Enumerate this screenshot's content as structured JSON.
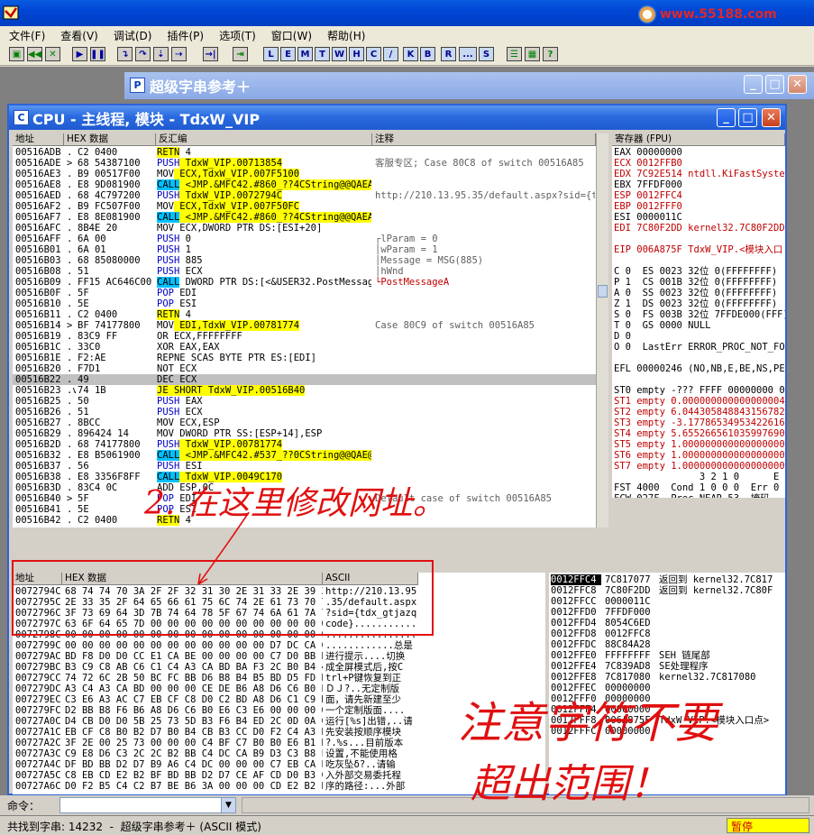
{
  "app": {
    "watermark": "www.55188.com"
  },
  "menu": [
    "文件(F)",
    "查看(V)",
    "调试(D)",
    "插件(P)",
    "选项(T)",
    "窗口(W)",
    "帮助(H)"
  ],
  "toolbar": {
    "letters": [
      "L",
      "E",
      "M",
      "T",
      "W",
      "H",
      "C",
      "/",
      "K",
      "B",
      "R",
      "...",
      "S"
    ]
  },
  "windows": {
    "strref_title": "超级字串参考＋",
    "cpu_title": "CPU - 主线程, 模块 - TdxW_VIP"
  },
  "disasm": {
    "headers": {
      "addr": "地址",
      "hex": "HEX 数据",
      "dis": "反汇编",
      "comment": "注释"
    },
    "rows": [
      {
        "a": "00516ADB",
        "m": ".",
        "h": "C2 0400",
        "d": "RETN 4",
        "c": ""
      },
      {
        "a": "00516ADE",
        "m": ">",
        "h": "68 54387100",
        "d": "PUSH TdxW_VIP.00713854",
        "c": "客服专区; Case 80C8 of switch 00516A85"
      },
      {
        "a": "00516AE3",
        "m": ".",
        "h": "B9 00517F00",
        "d": "MOV ECX,TdxW_VIP.007F5100",
        "c": ""
      },
      {
        "a": "00516AE8",
        "m": ".",
        "h": "E8 9D081900",
        "d": "CALL <JMP.&MFC42.#860_??4CString@@QAEAB",
        "c": ""
      },
      {
        "a": "00516AED",
        "m": ".",
        "h": "68 4C797200",
        "d": "PUSH TdxW_VIP.0072794C",
        "c": "http://210.13.95.35/default.aspx?sid={tc"
      },
      {
        "a": "00516AF2",
        "m": ".",
        "h": "B9 FC507F00",
        "d": "MOV ECX,TdxW_VIP.007F50FC",
        "c": ""
      },
      {
        "a": "00516AF7",
        "m": ".",
        "h": "E8 8E081900",
        "d": "CALL <JMP.&MFC42.#860_??4CString@@QAEAB",
        "c": ""
      },
      {
        "a": "00516AFC",
        "m": ".",
        "h": "8B4E 20",
        "d": "MOV ECX,DWORD PTR DS:[ESI+20]",
        "c": ""
      },
      {
        "a": "00516AFF",
        "m": ".",
        "h": "6A 00",
        "d": "PUSH 0",
        "c": "┌lParam = 0"
      },
      {
        "a": "00516B01",
        "m": ".",
        "h": "6A 01",
        "d": "PUSH 1",
        "c": "│wParam = 1"
      },
      {
        "a": "00516B03",
        "m": ".",
        "h": "68 85080000",
        "d": "PUSH 885",
        "c": "│Message = MSG(885)"
      },
      {
        "a": "00516B08",
        "m": ".",
        "h": "51",
        "d": "PUSH ECX",
        "c": "│hWnd"
      },
      {
        "a": "00516B09",
        "m": ".",
        "h": "FF15 AC646C00",
        "d": "CALL DWORD PTR DS:[<&USER32.PostMessage",
        "c": "└PostMessageA"
      },
      {
        "a": "00516B0F",
        "m": ".",
        "h": "5F",
        "d": "POP EDI",
        "c": ""
      },
      {
        "a": "00516B10",
        "m": ".",
        "h": "5E",
        "d": "POP ESI",
        "c": ""
      },
      {
        "a": "00516B11",
        "m": ".",
        "h": "C2 0400",
        "d": "RETN 4",
        "c": ""
      },
      {
        "a": "00516B14",
        "m": ">",
        "h": "BF 74177800",
        "d": "MOV EDI,TdxW_VIP.00781774",
        "c": "Case 80C9 of switch 00516A85"
      },
      {
        "a": "00516B19",
        "m": ".",
        "h": "83C9 FF",
        "d": "OR ECX,FFFFFFFF",
        "c": ""
      },
      {
        "a": "00516B1C",
        "m": ".",
        "h": "33C0",
        "d": "XOR EAX,EAX",
        "c": ""
      },
      {
        "a": "00516B1E",
        "m": ".",
        "h": "F2:AE",
        "d": "REPNE SCAS BYTE PTR ES:[EDI]",
        "c": ""
      },
      {
        "a": "00516B20",
        "m": ".",
        "h": "F7D1",
        "d": "NOT ECX",
        "c": ""
      },
      {
        "a": "00516B22",
        "m": ".",
        "h": "49",
        "d": "DEC ECX",
        "c": ""
      },
      {
        "a": "00516B23",
        "m": ".v",
        "h": "74 1B",
        "d": "JE SHORT TdxW_VIP.00516B40",
        "c": ""
      },
      {
        "a": "00516B25",
        "m": ".",
        "h": "50",
        "d": "PUSH EAX",
        "c": ""
      },
      {
        "a": "00516B26",
        "m": ".",
        "h": "51",
        "d": "PUSH ECX",
        "c": ""
      },
      {
        "a": "00516B27",
        "m": ".",
        "h": "8BCC",
        "d": "MOV ECX,ESP",
        "c": ""
      },
      {
        "a": "00516B29",
        "m": ".",
        "h": "896424 14",
        "d": "MOV DWORD PTR SS:[ESP+14],ESP",
        "c": ""
      },
      {
        "a": "00516B2D",
        "m": ".",
        "h": "68 74177800",
        "d": "PUSH TdxW_VIP.00781774",
        "c": ""
      },
      {
        "a": "00516B32",
        "m": ".",
        "h": "E8 B5061900",
        "d": "CALL <JMP.&MFC42.#537_??0CString@@QAE@P",
        "c": ""
      },
      {
        "a": "00516B37",
        "m": ".",
        "h": "56",
        "d": "PUSH ESI",
        "c": ""
      },
      {
        "a": "00516B38",
        "m": ".",
        "h": "E8 3356F8FF",
        "d": "CALL TdxW_VIP.0049C170",
        "c": ""
      },
      {
        "a": "00516B3D",
        "m": ".",
        "h": "83C4 0C",
        "d": "ADD ESP,0C",
        "c": ""
      },
      {
        "a": "00516B40",
        "m": ">",
        "h": "5F",
        "d": "POP EDI",
        "c": "Default case of switch 00516A85"
      },
      {
        "a": "00516B41",
        "m": ".",
        "h": "5E",
        "d": "POP ESI",
        "c": ""
      },
      {
        "a": "00516B42",
        "m": ".",
        "h": "C2 0400",
        "d": "RETN 4",
        "c": ""
      }
    ]
  },
  "registers": {
    "header": "寄存器 (FPU)",
    "lines": [
      "EAX 00000000",
      "ECX 0012FFB0",
      "EDX 7C92E514 ntdll.KiFastSystem",
      "EBX 7FFDF000",
      "ESP 0012FFC4",
      "EBP 0012FFF0",
      "ESI 0000011C",
      "EDI 7C80F2DD kernel32.7C80F2DD",
      "",
      "EIP 006A875F TdxW_VIP.<模块入口",
      "",
      "C 0  ES 0023 32位 0(FFFFFFFF)",
      "P 1  CS 001B 32位 0(FFFFFFFF)",
      "A 0  SS 0023 32位 0(FFFFFFFF)",
      "Z 1  DS 0023 32位 0(FFFFFFFF)",
      "S 0  FS 003B 32位 7FFDE000(FFF)",
      "T 0  GS 0000 NULL",
      "D 0",
      "O 0  LastErr ERROR_PROC_NOT_FOU",
      "",
      "EFL 00000246 (NO,NB,E,BE,NS,PE,",
      "",
      "ST0 empty -??? FFFF 00000000 00",
      "ST1 empty 0.0000000000000000040",
      "ST2 empty 6.0443058488431567820",
      "ST3 empty -3.177865349534226164",
      "ST4 empty 5.6552665610359976900",
      "ST5 empty 1.0000000000000000000",
      "ST6 empty 1.0000000000000000000",
      "ST7 empty 1.0000000000000000000",
      "               3 2 1 0      E S",
      "FST 4000  Cond 1 0 0 0  Err 0 0",
      "FCW 027F  Prec NEAR,53  掩码"
    ]
  },
  "dump": {
    "headers": {
      "addr": "地址",
      "hex": "HEX 数据",
      "ascii": "ASCII"
    },
    "rows": [
      {
        "a": "0072794C",
        "h": "68 74 74 70 3A 2F 2F 32 31 30 2E 31 33 2E 39 35",
        "s": "http://210.13.95"
      },
      {
        "a": "0072795C",
        "h": "2E 33 35 2F 64 65 66 61 75 6C 74 2E 61 73 70 78",
        "s": ".35/default.aspx"
      },
      {
        "a": "0072796C",
        "h": "3F 73 69 64 3D 7B 74 64 78 5F 67 74 6A 61 7A 71",
        "s": "?sid={tdx_gtjazq"
      },
      {
        "a": "0072797C",
        "h": "63 6F 64 65 7D 00 00 00 00 00 00 00 00 00 00 00",
        "s": "code}..........."
      },
      {
        "a": "0072798C",
        "h": "00 00 00 00 00 00 00 00 00 00 00 00 00 00 00 00",
        "s": "................"
      },
      {
        "a": "0072799C",
        "h": "00 00 00 00 00 00 00 00 00 00 00 00 D7 DC CA C7",
        "s": "............总是"
      },
      {
        "a": "007279AC",
        "h": "BD F8 D0 D0 CC E1 CA BE 00 00 00 00 C7 D0 BB BB",
        "s": "进行提示....切换"
      },
      {
        "a": "007279BC",
        "h": "B3 C9 C8 AB C6 C1 C4 A3 CA BD BA F3 2C B0 B4 43",
        "s": "成全屏模式后,按C"
      },
      {
        "a": "007279CC",
        "h": "74 72 6C 2B 50 BC FC BB D6 B8 B4 B5 BD D5 FD B3",
        "s": "trl+P键恢复到正"
      },
      {
        "a": "007279DC",
        "h": "A3 C4 A3 CA BD 00 00 00 CE DE B6 A8 D6 C6 B0 E6",
        "s": "ＤＪ?..无定制版"
      },
      {
        "a": "007279EC",
        "h": "C3 E6 A3 AC C7 EB CF C8 D0 C2 BD A8 D6 C1 C9 D9",
        "s": "面，请先新建至少"
      },
      {
        "a": "007279FC",
        "h": "D2 BB B8 F6 B6 A8 D6 C6 B0 E6 C3 E6 00 00 00 00",
        "s": "一个定制版面...."
      },
      {
        "a": "00727A0C",
        "h": "D4 CB D0 D0 5B 25 73 5D B3 F6 B4 ED 2C 0D 0A C7",
        "s": "运行[%s]出错,..请"
      },
      {
        "a": "00727A1C",
        "h": "EB CF C8 B0 B2 D7 B0 B4 CB B3 CC D0 F2 C4 A3 BF",
        "s": "先安装按顺序模块"
      },
      {
        "a": "00727A2C",
        "h": "3F 2E 00 25 73 00 00 00 C4 BF C7 B0 B0 E6 B1 BE",
        "s": "?.%s...目前版本"
      },
      {
        "a": "00727A3C",
        "h": "C9 E8 D6 C3 2C 2C B2 BB C4 DC CA B9 D3 C3 B8 F1",
        "s": "设置,不能使用格"
      },
      {
        "a": "00727A4C",
        "h": "DF BD BB D2 D7 B9 A6 C4 DC 00 00 00 C7 EB CA E4",
        "s": "吃灰坠δ?..请输"
      },
      {
        "a": "00727A5C",
        "h": "C8 EB CD E2 B2 BF BD BB D2 D7 CE AF CD D0 B3 CC",
        "s": "入外部交易委托程"
      },
      {
        "a": "00727A6C",
        "h": "D0 F2 B5 C4 C2 B7 BE B6 3A 00 00 00 CD E2 B2 BF",
        "s": "序的路径:...外部"
      }
    ]
  },
  "stack": {
    "rows": [
      {
        "a": "0012FFC4",
        "v": "7C817077",
        "c": "返回到 kernel32.7C817"
      },
      {
        "a": "0012FFC8",
        "v": "7C80F2DD",
        "c": "返回到 kernel32.7C80F"
      },
      {
        "a": "0012FFCC",
        "v": "0000011C",
        "c": ""
      },
      {
        "a": "0012FFD0",
        "v": "7FFDF000",
        "c": ""
      },
      {
        "a": "0012FFD4",
        "v": "8054C6ED",
        "c": ""
      },
      {
        "a": "0012FFD8",
        "v": "0012FFC8",
        "c": ""
      },
      {
        "a": "0012FFDC",
        "v": "88C84A28",
        "c": ""
      },
      {
        "a": "0012FFE0",
        "v": "FFFFFFFF",
        "c": "SEH 链尾部"
      },
      {
        "a": "0012FFE4",
        "v": "7C839AD8",
        "c": "SE处理程序"
      },
      {
        "a": "0012FFE8",
        "v": "7C817080",
        "c": "kernel32.7C817080"
      },
      {
        "a": "0012FFEC",
        "v": "00000000",
        "c": ""
      },
      {
        "a": "0012FFF0",
        "v": "00000000",
        "c": ""
      },
      {
        "a": "0012FFF4",
        "v": "00000000",
        "c": ""
      },
      {
        "a": "0012FFF8",
        "v": "006A875F",
        "c": "TdxW_VIP.<模块入口点>"
      },
      {
        "a": "0012FFFC",
        "v": "00000000",
        "c": ""
      }
    ]
  },
  "command": {
    "label": "命令："
  },
  "status": {
    "text": "共找到字串: 14232  -  超级字串参考＋ (ASCII 模式)",
    "state": "暂停"
  },
  "annotations": {
    "note1": "2. 在这里修改网址。",
    "note2a": "注意字符不要",
    "note2b": "超出范围！"
  }
}
